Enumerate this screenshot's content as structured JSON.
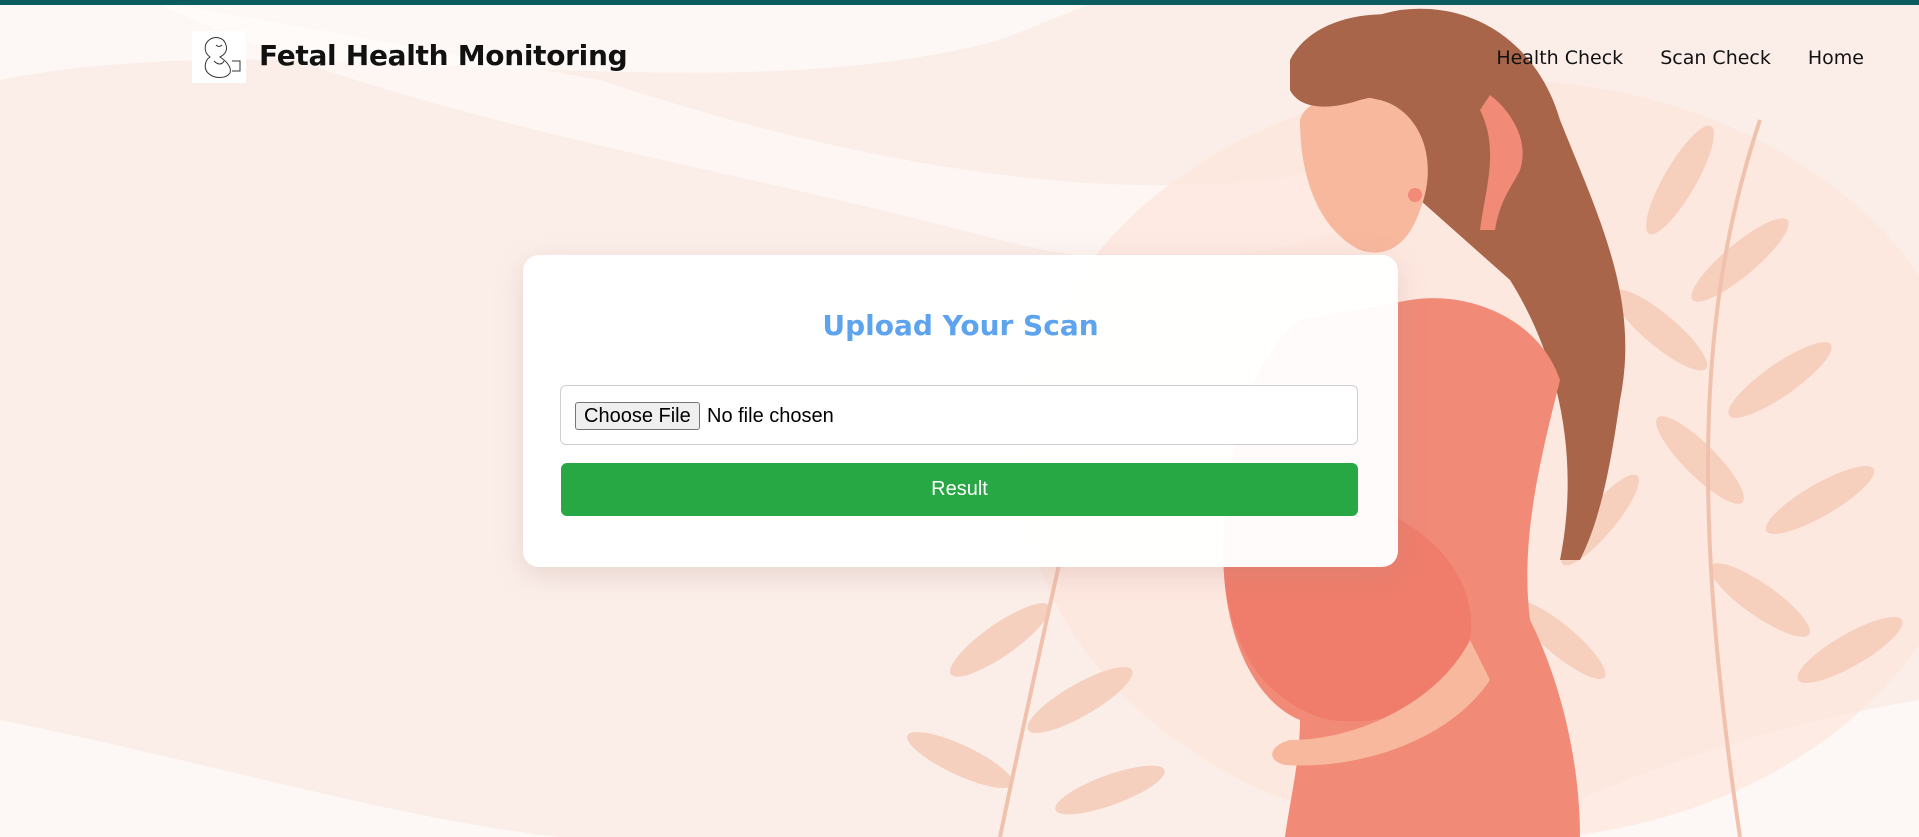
{
  "header": {
    "title": "Fetal Health Monitoring",
    "logo_icon": "fetus-sketch-icon"
  },
  "nav": {
    "items": [
      {
        "label": "Health Check"
      },
      {
        "label": "Scan Check"
      },
      {
        "label": "Home"
      }
    ]
  },
  "upload": {
    "title": "Upload Your Scan",
    "choose_label": "Choose File",
    "file_status": "No file chosen",
    "result_label": "Result"
  },
  "colors": {
    "top_bar": "#0b5c5e",
    "title_blue": "#5ea3ee",
    "result_green": "#28a745",
    "background": "#fbeee9"
  }
}
